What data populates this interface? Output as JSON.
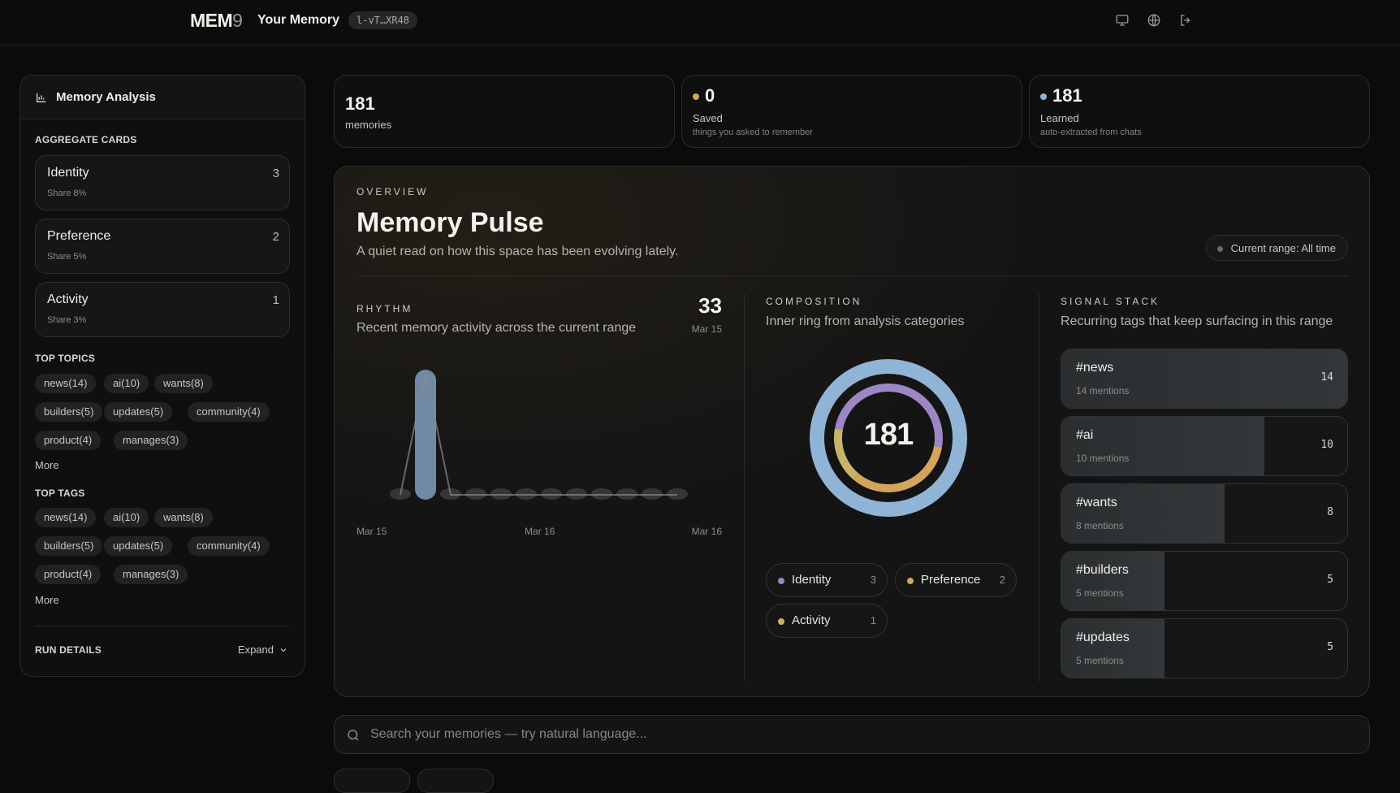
{
  "header": {
    "logo_main": "MEM",
    "logo_num": "9",
    "title": "Your Memory",
    "key": "l-vT…XR48"
  },
  "sidebar": {
    "title": "Memory Analysis",
    "aggregate_label": "AGGREGATE CARDS",
    "aggregate": [
      {
        "name": "Identity",
        "count": "3",
        "share": "Share 8%"
      },
      {
        "name": "Preference",
        "count": "2",
        "share": "Share 5%"
      },
      {
        "name": "Activity",
        "count": "1",
        "share": "Share 3%"
      }
    ],
    "topics_label": "TOP TOPICS",
    "topics": [
      "news(14)",
      "ai(10)",
      "wants(8)",
      "builders(5)",
      "updates(5)",
      "community(4)",
      "product(4)",
      "manages(3)"
    ],
    "topics_more": "More",
    "tags_label": "TOP TAGS",
    "tags": [
      "news(14)",
      "ai(10)",
      "wants(8)",
      "builders(5)",
      "updates(5)",
      "community(4)",
      "product(4)",
      "manages(3)"
    ],
    "tags_more": "More",
    "run_label": "RUN DETAILS",
    "run_expand": "Expand"
  },
  "stats": [
    {
      "value": "181",
      "label": "memories",
      "sub": "",
      "dot": ""
    },
    {
      "value": "0",
      "label": "Saved",
      "sub": "things you asked to remember",
      "dot": "#d4a45a"
    },
    {
      "value": "181",
      "label": "Learned",
      "sub": "auto-extracted from chats",
      "dot": "#8fb4d6"
    }
  ],
  "overview": {
    "eyebrow": "OVERVIEW",
    "title": "Memory Pulse",
    "lead": "A quiet read on how this space has been evolving lately.",
    "range": "Current range: All time",
    "rhythm": {
      "label": "RHYTHM",
      "caption": "Recent memory activity across the current range",
      "peak_value": "33",
      "peak_date": "Mar 15",
      "x_labels": [
        "Mar 15",
        "Mar 16",
        "Mar 16"
      ]
    },
    "composition": {
      "label": "COMPOSITION",
      "caption": "Inner ring from analysis categories",
      "total": "181",
      "legend": [
        {
          "name": "Identity",
          "count": "3",
          "color": "#9c86c4"
        },
        {
          "name": "Preference",
          "count": "2",
          "color": "#d4a45a"
        },
        {
          "name": "Activity",
          "count": "1",
          "color": "#c8b36a"
        }
      ]
    },
    "signal": {
      "label": "SIGNAL STACK",
      "caption": "Recurring tags that keep surfacing in this range",
      "tags": [
        {
          "name": "#news",
          "mentions": "14 mentions",
          "count": "14",
          "share": 1.0
        },
        {
          "name": "#ai",
          "mentions": "10 mentions",
          "count": "10",
          "share": 0.71
        },
        {
          "name": "#wants",
          "mentions": "8 mentions",
          "count": "8",
          "share": 0.57
        },
        {
          "name": "#builders",
          "mentions": "5 mentions",
          "count": "5",
          "share": 0.36
        },
        {
          "name": "#updates",
          "mentions": "5 mentions",
          "count": "5",
          "share": 0.36
        }
      ]
    }
  },
  "search": {
    "placeholder": "Search your memories — try natural language..."
  },
  "chart_data": {
    "type": "bar",
    "categories": [
      "Mar 15",
      "Mar 15",
      "Mar 15",
      "Mar 15",
      "Mar 15",
      "Mar 15",
      "Mar 16",
      "Mar 16",
      "Mar 16",
      "Mar 16",
      "Mar 16",
      "Mar 16"
    ],
    "values": [
      0,
      33,
      0,
      0,
      0,
      0,
      0,
      0,
      0,
      0,
      0,
      0
    ],
    "title": "",
    "xlabel": "",
    "ylabel": "",
    "ylim": [
      0,
      33
    ],
    "grid": false
  },
  "donut_data": {
    "type": "pie",
    "outer": [
      {
        "name": "Learned",
        "value": 181,
        "color": "#8fb4d6"
      }
    ],
    "inner": [
      {
        "name": "Identity",
        "value": 3,
        "color": "#9c86c4"
      },
      {
        "name": "Preference",
        "value": 2,
        "color": "#d4a45a"
      },
      {
        "name": "Activity",
        "value": 1,
        "color": "#c8b36a"
      }
    ]
  }
}
